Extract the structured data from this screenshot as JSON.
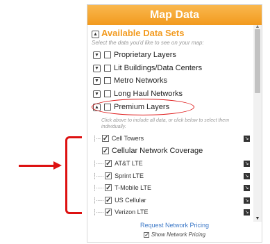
{
  "panel": {
    "title": "Map Data",
    "section_title": "Available Data Sets",
    "section_subtitle": "Select the data you'd like to see on your map:",
    "layers": [
      {
        "label": "Proprietary Layers",
        "expanded": false
      },
      {
        "label": "Lit Buildings/Data Centers",
        "expanded": false
      },
      {
        "label": "Metro Networks",
        "expanded": false
      },
      {
        "label": "Long Haul Networks",
        "expanded": false
      },
      {
        "label": "Premium Layers",
        "expanded": true
      }
    ],
    "hint": "Click above to include all data, or click below to select them individually.",
    "premium_items": {
      "cell_towers": "Cell Towers",
      "group": "Cellular Network Coverage",
      "carriers": [
        "AT&T LTE",
        "Sprint LTE",
        "T-Mobile LTE",
        "US Cellular",
        "Verizon LTE"
      ]
    },
    "footer": {
      "link": "Request Network Pricing",
      "show_label": "Show Network Pricing"
    }
  },
  "colors": {
    "header": "#f29a1e",
    "section_title": "#f29a1e",
    "annotation": "#dd1111",
    "link": "#3b78c7"
  }
}
